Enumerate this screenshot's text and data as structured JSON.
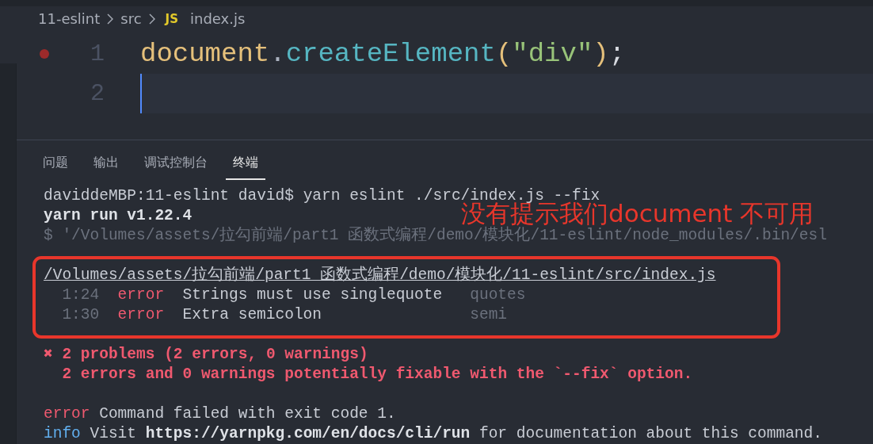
{
  "breadcrumb": {
    "folders": [
      "11-eslint",
      "src"
    ],
    "file_icon": "JS",
    "file": "index.js"
  },
  "editor": {
    "lines": [
      {
        "number": "1",
        "breakpoint": true,
        "current": false,
        "tokens": [
          {
            "kind": "object",
            "text": "document"
          },
          {
            "kind": "punct",
            "text": "."
          },
          {
            "kind": "method",
            "text": "createElement"
          },
          {
            "kind": "paren",
            "text": "("
          },
          {
            "kind": "string",
            "text": "\"div\""
          },
          {
            "kind": "paren",
            "text": ")"
          },
          {
            "kind": "plain",
            "text": ";"
          }
        ]
      },
      {
        "number": "2",
        "breakpoint": false,
        "current": true
      }
    ]
  },
  "panel": {
    "tabs": [
      {
        "label": "问题",
        "selected": false
      },
      {
        "label": "输出",
        "selected": false
      },
      {
        "label": "调试控制台",
        "selected": false
      },
      {
        "label": "终端",
        "selected": true
      }
    ]
  },
  "terminal": {
    "lines": [
      {
        "kind": "text",
        "segments": [
          {
            "kind": "plain",
            "text": "daviddeMBP:11-eslint david$ yarn eslint ./src/index.js --fix"
          }
        ]
      },
      {
        "kind": "text",
        "segments": [
          {
            "kind": "bold",
            "text": "yarn run v1.22.4"
          }
        ]
      },
      {
        "kind": "text",
        "segments": [
          {
            "kind": "dim",
            "text": "$ '/Volumes/assets/拉勾前端/part1 函数式编程/demo/模块化/11-eslint/node_modules/.bin/esl"
          }
        ]
      },
      {
        "kind": "blank"
      },
      {
        "kind": "text",
        "segments": [
          {
            "kind": "underline",
            "text": "/Volumes/assets/拉勾前端/part1 函数式编程/demo/模块化/11-eslint/src/index.js"
          }
        ]
      },
      {
        "kind": "problem",
        "location": "1:24",
        "severity": "error",
        "message": "Strings must use singlequote",
        "rule": "quotes"
      },
      {
        "kind": "problem",
        "location": "1:30",
        "severity": "error",
        "message": "Extra semicolon",
        "rule": "semi"
      },
      {
        "kind": "blank"
      },
      {
        "kind": "text",
        "segments": [
          {
            "kind": "error-mark",
            "text": "✖"
          },
          {
            "kind": "error-bold",
            "text": "2 problems (2 errors, 0 warnings)"
          }
        ]
      },
      {
        "kind": "continuation",
        "segments": [
          {
            "kind": "error-bold",
            "text": "2 errors and 0 warnings potentially fixable with the `--fix` option."
          }
        ]
      },
      {
        "kind": "blank"
      },
      {
        "kind": "text",
        "segments": [
          {
            "kind": "error",
            "text": "error"
          },
          {
            "kind": "plain",
            "text": "Command failed with exit code 1."
          }
        ]
      },
      {
        "kind": "text",
        "segments": [
          {
            "kind": "info",
            "text": "info"
          },
          {
            "kind": "plain",
            "text": "Visit"
          },
          {
            "kind": "bold",
            "text": "https://yarnpkg.com/en/docs/cli/run"
          },
          {
            "kind": "plain",
            "text": "for documentation about this command."
          }
        ]
      }
    ]
  },
  "annotation": {
    "text": "没有提示我们document 不可用"
  }
}
